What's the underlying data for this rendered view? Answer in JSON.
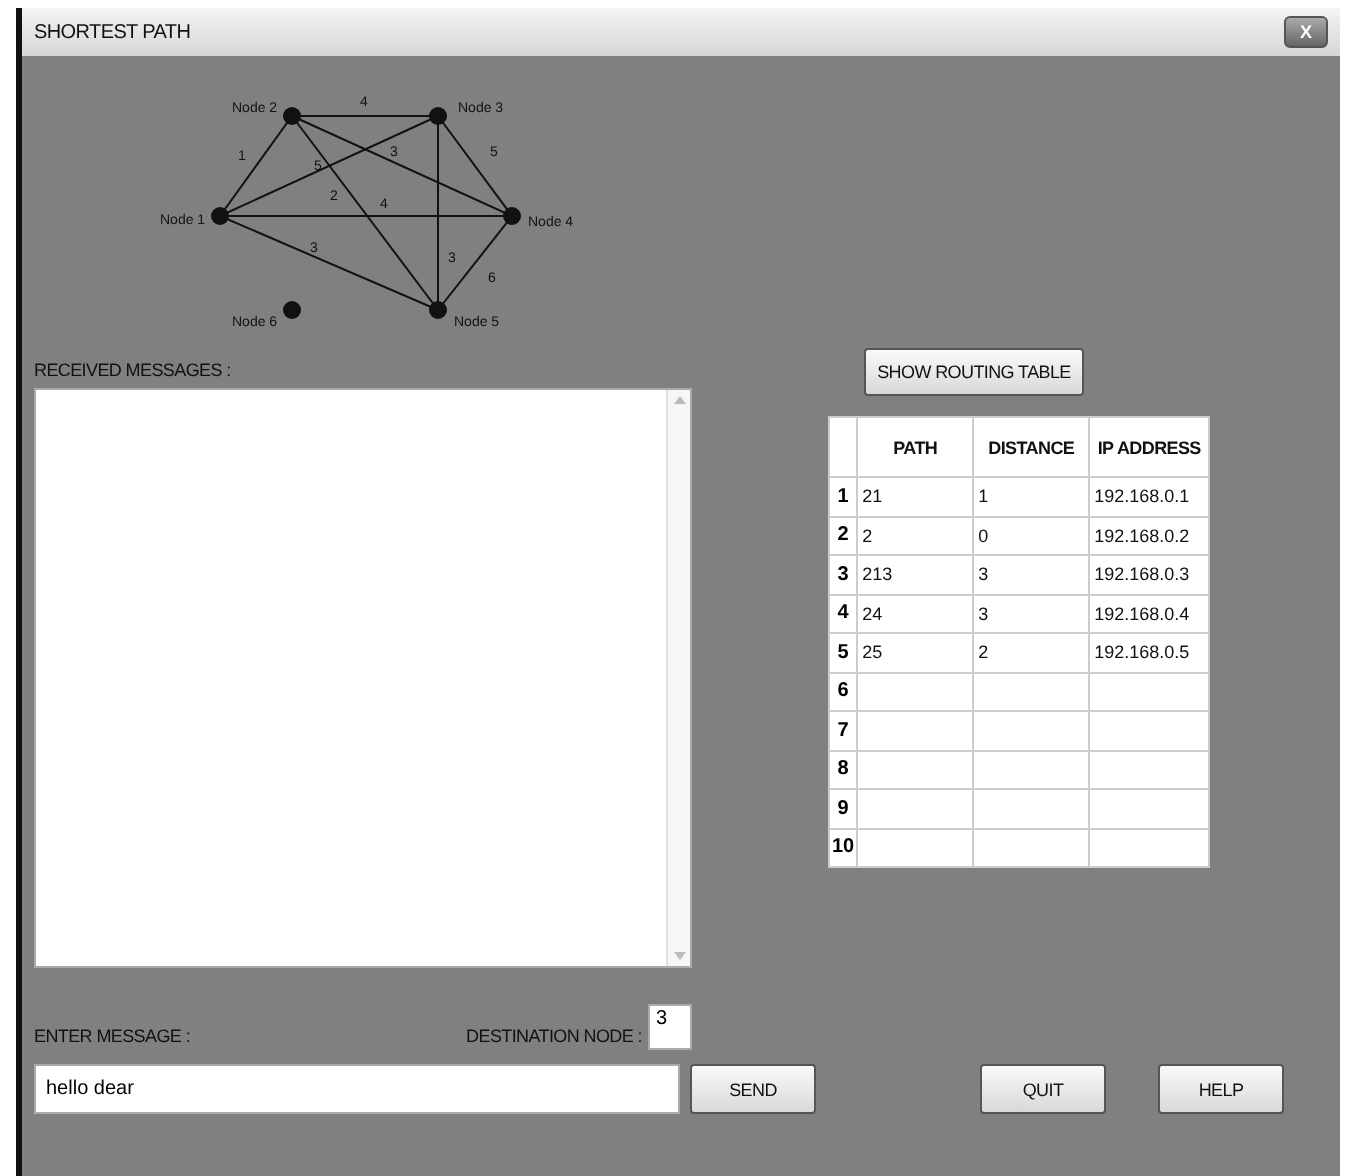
{
  "window": {
    "title": "SHORTEST PATH",
    "close_label": "X"
  },
  "graph": {
    "nodes": [
      {
        "label": "Node 1"
      },
      {
        "label": "Node 2"
      },
      {
        "label": "Node 3"
      },
      {
        "label": "Node 4"
      },
      {
        "label": "Node 5"
      },
      {
        "label": "Node 6"
      }
    ],
    "edge_weights": [
      "1",
      "4",
      "5",
      "2",
      "3",
      "5",
      "4",
      "3",
      "3",
      "6"
    ]
  },
  "received_label": "RECEIVED MESSAGES :",
  "show_routing_button": "SHOW ROUTING TABLE",
  "table": {
    "columns": [
      "PATH",
      "DISTANCE",
      "IP ADDRESS"
    ],
    "rows": [
      {
        "index": "1",
        "cells": [
          "21",
          "1",
          "192.168.0.1"
        ]
      },
      {
        "index": "2",
        "cells": [
          "2",
          "0",
          "192.168.0.2"
        ]
      },
      {
        "index": "3",
        "cells": [
          "213",
          "3",
          "192.168.0.3"
        ]
      },
      {
        "index": "4",
        "cells": [
          "24",
          "3",
          "192.168.0.4"
        ]
      },
      {
        "index": "5",
        "cells": [
          "25",
          "2",
          "192.168.0.5"
        ]
      },
      {
        "index": "6",
        "cells": []
      },
      {
        "index": "7",
        "cells": []
      },
      {
        "index": "8",
        "cells": []
      },
      {
        "index": "9",
        "cells": []
      },
      {
        "index": "10",
        "cells": []
      }
    ]
  },
  "enter_label": "ENTER MESSAGE :",
  "destination_label": "DESTINATION NODE :",
  "destination_value": "3",
  "message_value": "hello dear",
  "buttons": [
    "SEND",
    "QUIT",
    "HELP"
  ]
}
